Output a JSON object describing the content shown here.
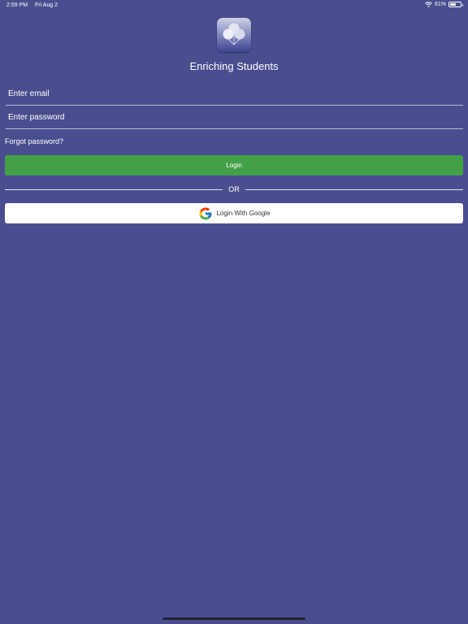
{
  "status_bar": {
    "time": "2:59 PM",
    "date": "Fri Aug 2",
    "battery_percent": "61%",
    "battery_level": 0.61,
    "icons": [
      "wifi-icon",
      "battery-icon"
    ]
  },
  "app": {
    "logo_icon": "balloons-logo-icon",
    "title": "Enriching Students"
  },
  "form": {
    "email_placeholder": "Enter email",
    "email_value": "",
    "password_placeholder": "Enter password",
    "password_value": "",
    "forgot_password_label": "Forgot password?",
    "login_label": "Login",
    "divider_label": "OR",
    "google_label": "Login With Google",
    "google_icon": "google-g-icon"
  },
  "colors": {
    "background": "#4a4e8f",
    "login_button": "#43a047",
    "google_button": "#ffffff",
    "text": "#ffffff"
  }
}
